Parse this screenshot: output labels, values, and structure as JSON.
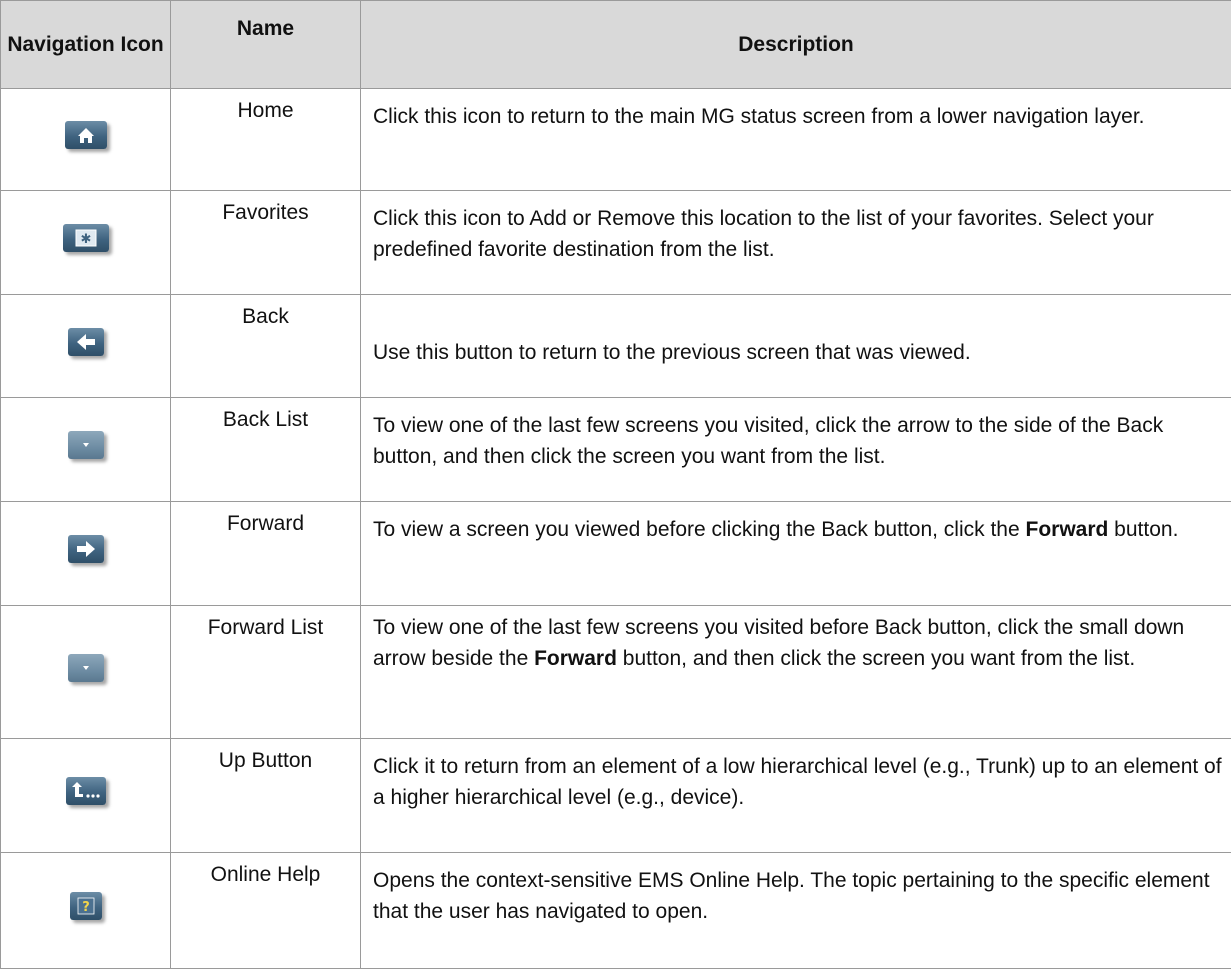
{
  "table": {
    "headers": [
      "Navigation Icon",
      "Name",
      "Description"
    ],
    "rows": [
      {
        "icon": "home-icon",
        "name": "Home",
        "desc": "Click this icon to return to the main MG status screen from a lower navigation layer."
      },
      {
        "icon": "favorites-icon",
        "name": "Favorites",
        "desc": "Click this icon to Add or Remove this location to the list of your favorites. Select your predefined favorite destination from the list."
      },
      {
        "icon": "back-arrow-icon",
        "name": "Back",
        "desc": "Use this button to return to the previous screen that was viewed."
      },
      {
        "icon": "back-list-dropdown-icon",
        "name": "Back List",
        "desc": "To view one of the last few screens you visited, click the arrow to the side of the Back button, and then click the screen you want from the list."
      },
      {
        "icon": "forward-arrow-icon",
        "name": "Forward",
        "desc_parts": [
          "To view a screen you viewed before clicking the Back button, click the ",
          "Forward",
          " button."
        ]
      },
      {
        "icon": "forward-list-dropdown-icon",
        "name": "Forward List",
        "desc_parts": [
          "To view one of the last few screens you visited before Back button, click the small down arrow beside the ",
          "Forward",
          " button, and then click the screen you want from the list."
        ]
      },
      {
        "icon": "up-button-icon",
        "name": "Up Button",
        "desc": "Click it to return from an element of a low hierarchical level (e.g., Trunk) up to an element of a higher hierarchical level (e.g., device)."
      },
      {
        "icon": "help-icon",
        "name": "Online Help",
        "desc": "Opens the context-sensitive EMS Online Help. The topic pertaining to the specific element that the user has navigated to open."
      }
    ]
  },
  "colors": {
    "header_bg": "#d9d9d9",
    "border": "#9a9a9a",
    "icon_blue": "#3f6380"
  }
}
